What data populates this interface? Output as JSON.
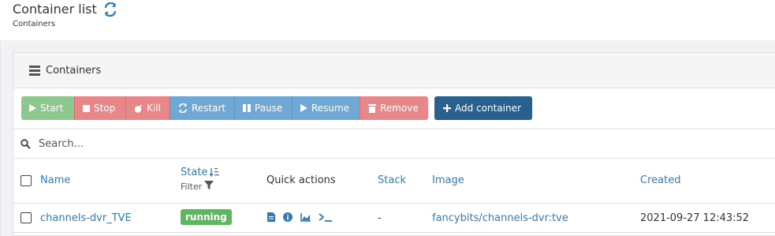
{
  "header": {
    "title": "Container list",
    "breadcrumb": "Containers"
  },
  "widget": {
    "title": "Containers"
  },
  "toolbar": {
    "start": "Start",
    "stop": "Stop",
    "kill": "Kill",
    "restart": "Restart",
    "pause": "Pause",
    "resume": "Resume",
    "remove": "Remove",
    "add": "Add container"
  },
  "search": {
    "placeholder": "Search..."
  },
  "columns": {
    "name": "Name",
    "state": "State",
    "state_filter": "Filter",
    "quick_actions": "Quick actions",
    "stack": "Stack",
    "image": "Image",
    "created": "Created"
  },
  "rows": [
    {
      "name": "channels-dvr_TVE",
      "state": "running",
      "stack": "-",
      "image": "fancybits/channels-dvr:tve",
      "created": "2021-09-27 12:43:52"
    }
  ],
  "colors": {
    "link": "#337ab7",
    "running": "#5cb85c",
    "add_button": "#286090"
  }
}
